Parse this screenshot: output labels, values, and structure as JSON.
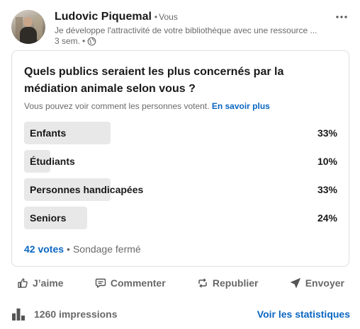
{
  "author": {
    "name": "Ludovic Piquemal",
    "separator": "•",
    "relation": "Vous",
    "headline": "Je développe l'attractivité de votre bibliothèque avec une ressource ...",
    "time": "3 sem.",
    "time_separator": "•"
  },
  "poll": {
    "question": "Quels publics seraient les plus concernés par la médiation animale selon vous ?",
    "visibility_text": "Vous pouvez voir comment les personnes votent.",
    "learn_more": "En savoir plus",
    "options": [
      {
        "label": "Enfants",
        "percent_label": "33%",
        "percent": 33
      },
      {
        "label": "Étudiants",
        "percent_label": "10%",
        "percent": 10
      },
      {
        "label": "Personnes handicapées",
        "percent_label": "33%",
        "percent": 33
      },
      {
        "label": "Seniors",
        "percent_label": "24%",
        "percent": 24
      }
    ],
    "votes": "42 votes",
    "footer_separator": "•",
    "status": "Sondage fermé"
  },
  "actions": {
    "like": "J’aime",
    "comment": "Commenter",
    "repost": "Republier",
    "send": "Envoyer"
  },
  "stats": {
    "impressions": "1260 impressions",
    "view_stats": "Voir les statistiques"
  },
  "icons": {
    "more": "more-horizontal-icon",
    "visibility": "globe-icon",
    "like": "thumbs-up-icon",
    "comment": "comment-bubble-icon",
    "repost": "repost-arrows-icon",
    "send": "send-plane-icon",
    "impressions": "bar-chart-icon"
  },
  "colors": {
    "link": "#0a66c2",
    "bar": "#e8e8e8",
    "muted": "#666666"
  }
}
